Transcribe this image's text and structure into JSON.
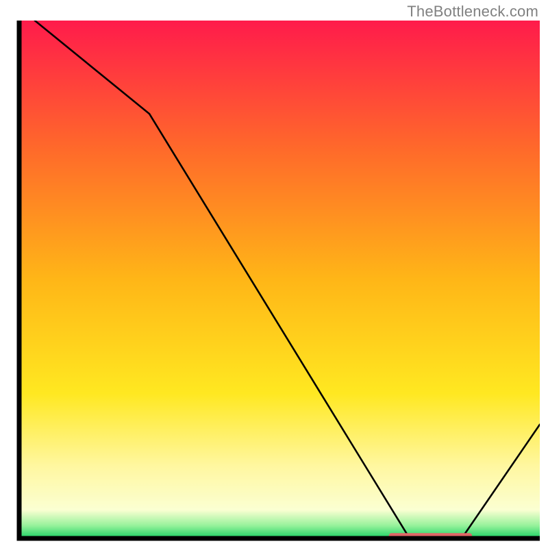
{
  "watermark": "TheBottleneck.com",
  "chart_data": {
    "type": "line",
    "title": "",
    "xlabel": "",
    "ylabel": "",
    "xlim": [
      0,
      100
    ],
    "ylim": [
      0,
      100
    ],
    "x": [
      3,
      25,
      75,
      85,
      100
    ],
    "values": [
      100,
      82,
      0,
      0,
      22
    ],
    "optimal_band": {
      "x_start": 71,
      "x_end": 87,
      "y": 0.5
    },
    "gradient_stops": [
      {
        "pos": 0.0,
        "color": "#ff1b4b"
      },
      {
        "pos": 0.25,
        "color": "#ff6a2a"
      },
      {
        "pos": 0.5,
        "color": "#ffb617"
      },
      {
        "pos": 0.72,
        "color": "#ffe821"
      },
      {
        "pos": 0.86,
        "color": "#fff7a0"
      },
      {
        "pos": 0.945,
        "color": "#fbffd2"
      },
      {
        "pos": 0.975,
        "color": "#97f29b"
      },
      {
        "pos": 1.0,
        "color": "#19d262"
      }
    ]
  },
  "plot": {
    "margin_left": 28,
    "margin_top": 30,
    "inner_width": 760,
    "inner_height": 756
  }
}
